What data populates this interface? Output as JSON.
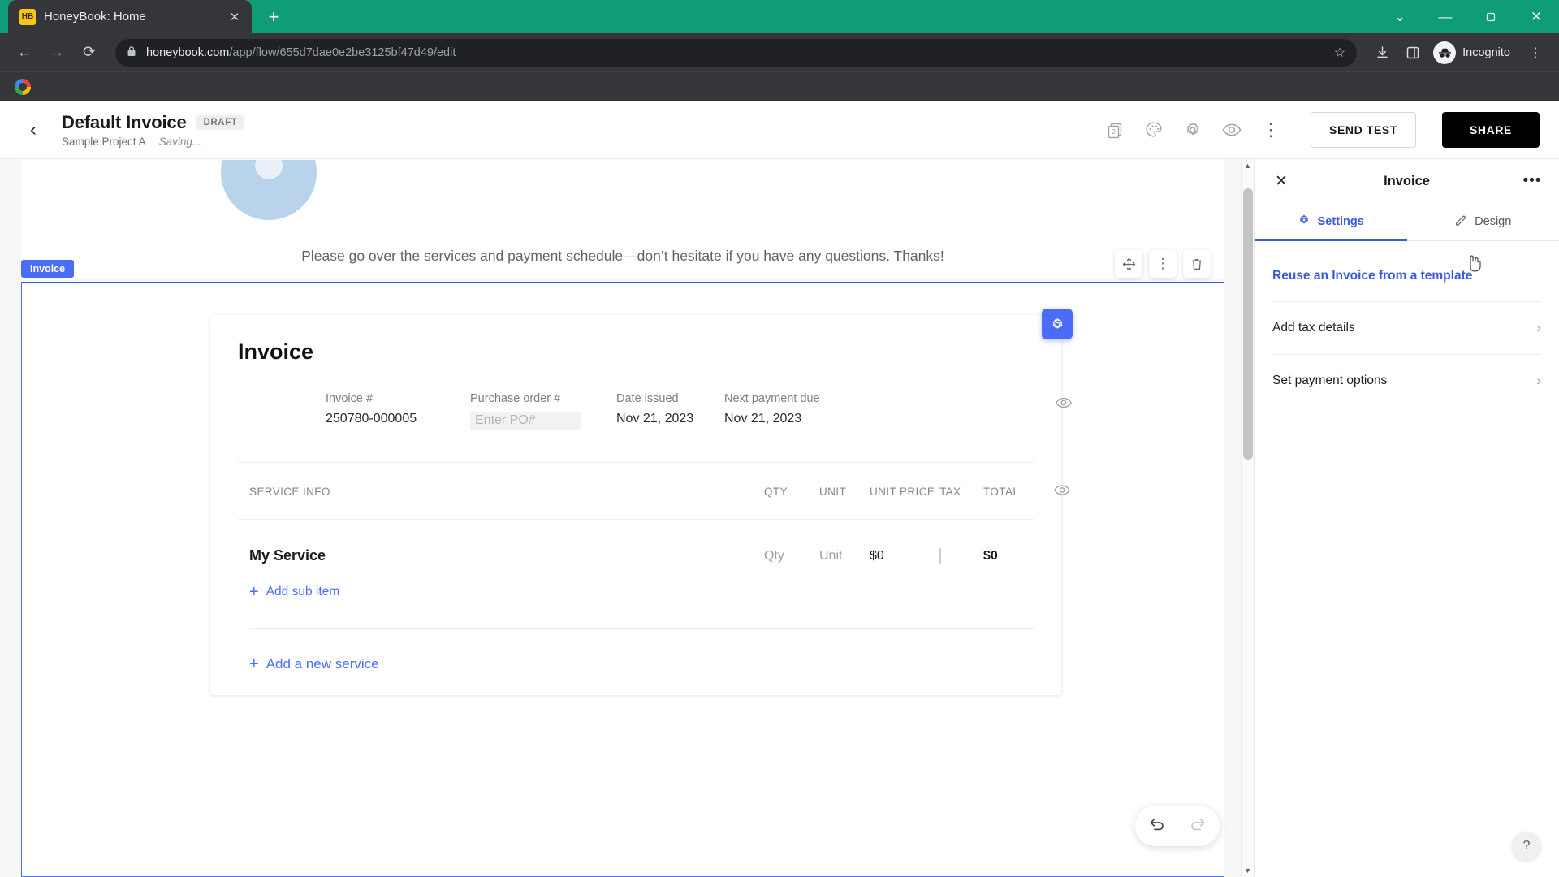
{
  "browser": {
    "tab": {
      "title": "HoneyBook: Home",
      "favicon_text": "HB",
      "favicon_name": "honeybook-favicon",
      "close_label": "✕"
    },
    "newtab_label": "+",
    "window_controls": {
      "expand": "⌄",
      "minimize": "—",
      "maximize": "❐",
      "close": "✕"
    },
    "nav": {
      "back": "←",
      "forward": "→",
      "reload": "⟳"
    },
    "omnibox": {
      "lock_icon": "🔒",
      "url_domain": "honeybook.com",
      "url_path": "/app/flow/655d7dae0e2be3125bf47d49/edit",
      "bookmark_star": "☆"
    },
    "actions": {
      "download": "⬇",
      "side_panel": "▮",
      "menu": "⋮"
    },
    "profile": {
      "label": "Incognito",
      "icon": "🕵"
    },
    "bookmarks": [
      {
        "name": "google-bookmark",
        "label": ""
      }
    ]
  },
  "app_header": {
    "back_icon": "‹",
    "title": "Default Invoice",
    "status_badge": "DRAFT",
    "project": "Sample Project A",
    "save_state": "Saving...",
    "icons": [
      {
        "name": "pages-icon",
        "badge": "2"
      },
      {
        "name": "palette-icon"
      },
      {
        "name": "settings-gear-icon"
      },
      {
        "name": "preview-eye-icon"
      },
      {
        "name": "more-vertical-icon",
        "glyph": "⋮"
      }
    ],
    "send_test_label": "SEND TEST",
    "share_label": "SHARE"
  },
  "canvas": {
    "greeting": "Please go over the services and payment schedule—don’t hesitate if you have any questions. Thanks!",
    "block_tag": "Invoice",
    "block_tools": [
      {
        "name": "move-block-icon",
        "glyph": "✥"
      },
      {
        "name": "block-options-icon",
        "glyph": "⋮"
      },
      {
        "name": "delete-block-icon",
        "glyph": "🗑"
      }
    ],
    "invoice": {
      "heading": "Invoice",
      "gear_icon": "⚙",
      "meta": [
        {
          "label": "Invoice #",
          "value": "250780-000005",
          "placeholder": false
        },
        {
          "label": "Purchase order #",
          "value": "Enter PO#",
          "placeholder": true
        },
        {
          "label": "Date issued",
          "value": "Nov 21, 2023",
          "placeholder": false
        },
        {
          "label": "Next payment due",
          "value": "Nov 21, 2023",
          "placeholder": false
        }
      ],
      "columns": {
        "service": "SERVICE INFO",
        "qty": "QTY",
        "unit": "UNIT",
        "unit_price": "UNIT PRICE",
        "tax": "TAX",
        "total": "TOTAL"
      },
      "rows": [
        {
          "name": "My Service",
          "qty": "Qty",
          "unit": "Unit",
          "unit_price": "$0",
          "tax": "",
          "total": "$0"
        }
      ],
      "add_sub_item": "Add sub item",
      "add_new_service": "Add a new service",
      "plus_glyph": "+"
    },
    "undo_redo": {
      "undo": "↩",
      "redo": "↪"
    },
    "scrollbar": {
      "up": "▲",
      "down": "▼"
    }
  },
  "right_panel": {
    "close_icon": "✕",
    "title": "Invoice",
    "more_icon": "•••",
    "tabs": [
      {
        "label": "Settings",
        "icon": "⚙",
        "active": true
      },
      {
        "label": "Design",
        "icon": "✎",
        "active": false
      }
    ],
    "template_link": "Reuse an Invoice from a template",
    "rows": [
      {
        "label": "Add tax details",
        "chevron": "›"
      },
      {
        "label": "Set payment options",
        "chevron": "›"
      }
    ],
    "help_icon": "?"
  },
  "colors": {
    "brand_green": "#0f9d77",
    "accent_blue": "#4a6cf7",
    "link_blue": "#3b5bdb",
    "dark_chrome": "#35363a",
    "omnibox": "#202124"
  }
}
